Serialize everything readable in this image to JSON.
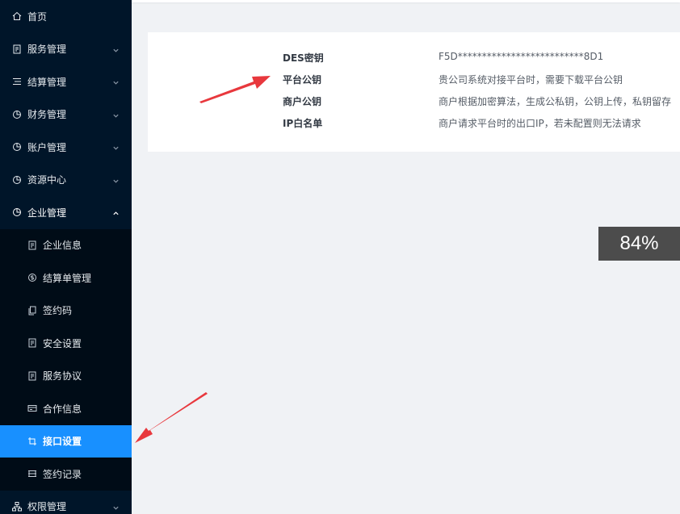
{
  "sidebar": {
    "items": [
      {
        "label": "首页",
        "icon": "home-icon"
      },
      {
        "label": "服务管理",
        "icon": "document-icon"
      },
      {
        "label": "结算管理",
        "icon": "list-icon"
      },
      {
        "label": "财务管理",
        "icon": "pie-chart-icon"
      },
      {
        "label": "账户管理",
        "icon": "pie-chart-icon"
      },
      {
        "label": "资源中心",
        "icon": "pie-chart-icon"
      },
      {
        "label": "企业管理",
        "icon": "pie-chart-icon"
      }
    ],
    "submenu": [
      {
        "label": "企业信息",
        "icon": "document-icon"
      },
      {
        "label": "结算单管理",
        "icon": "coin-icon"
      },
      {
        "label": "签约码",
        "icon": "copy-icon"
      },
      {
        "label": "安全设置",
        "icon": "document-icon"
      },
      {
        "label": "服务协议",
        "icon": "document-icon"
      },
      {
        "label": "合作信息",
        "icon": "card-icon"
      },
      {
        "label": "接口设置",
        "icon": "crop-icon"
      },
      {
        "label": "签约记录",
        "icon": "list-box-icon"
      }
    ],
    "bottom": {
      "label": "权限管理",
      "icon": "org-chart-icon"
    }
  },
  "interface": {
    "rows": [
      {
        "key": "DES密钥",
        "value": "F5D**************************8D1"
      },
      {
        "key": "平台公钥",
        "value": "贵公司系统对接平台时，需要下载平台公钥"
      },
      {
        "key": "商户公钥",
        "value": "商户根据加密算法，生成公私钥，公钥上传，私钥留存"
      },
      {
        "key": "IP白名单",
        "value": "商户请求平台时的出口IP，若未配置则无法请求"
      }
    ]
  },
  "zoom_badge": "84%",
  "colors": {
    "sidebar_bg": "#001529",
    "submenu_bg": "#000c17",
    "active": "#1890ff",
    "annotation_arrow": "#e8383d"
  }
}
